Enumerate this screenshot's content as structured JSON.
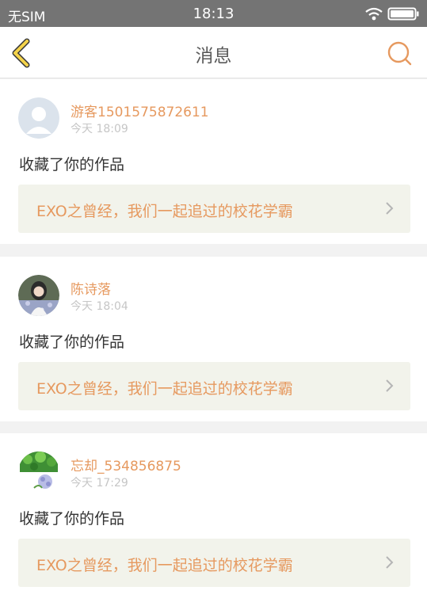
{
  "status_bar": {
    "carrier": "无SIM",
    "time": "18:13",
    "icons": [
      "wifi-icon",
      "battery-icon"
    ]
  },
  "header": {
    "title": "消息",
    "back_icon": "back-arrow-icon",
    "search_icon": "search-icon"
  },
  "colors": {
    "accent": "#e6995f",
    "status_bar": "#747474",
    "card_background": "#ffffff",
    "link_background": "#f2f3eb"
  },
  "notifications": [
    {
      "username": "游客1501575872611",
      "time": "今天 18:09",
      "action": "收藏了你的作品",
      "work_title": "EXO之曾经，我们一起追过的校花学霸"
    },
    {
      "username": "陈诗落",
      "time": "今天 18:04",
      "action": "收藏了你的作品",
      "work_title": "EXO之曾经，我们一起追过的校花学霸"
    },
    {
      "username": "忘却_534856875",
      "time": "今天 17:29",
      "action": "收藏了你的作品",
      "work_title": "EXO之曾经，我们一起追过的校花学霸"
    }
  ]
}
